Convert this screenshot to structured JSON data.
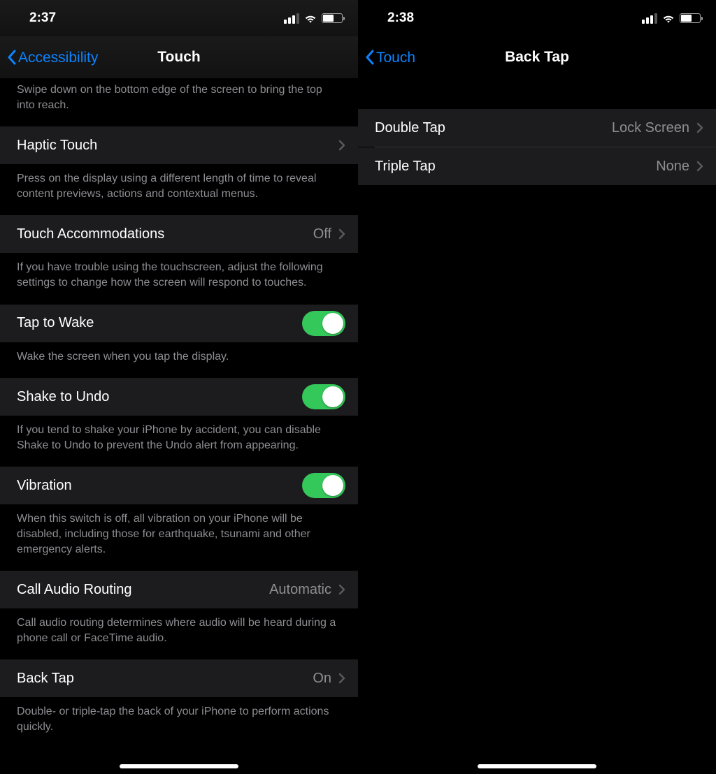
{
  "left": {
    "status_time": "2:37",
    "nav_back": "Accessibility",
    "nav_title": "Touch",
    "reachability_footer": "Swipe down on the bottom edge of the screen to bring the top into reach.",
    "haptic_touch": "Haptic Touch",
    "haptic_touch_footer": "Press on the display using a different length of time to reveal content previews, actions and contextual menus.",
    "touch_accommodations": "Touch Accommodations",
    "touch_accommodations_value": "Off",
    "touch_accommodations_footer": "If you have trouble using the touchscreen, adjust the following settings to change how the screen will respond to touches.",
    "tap_to_wake": "Tap to Wake",
    "tap_to_wake_footer": "Wake the screen when you tap the display.",
    "shake_to_undo": "Shake to Undo",
    "shake_to_undo_footer": "If you tend to shake your iPhone by accident, you can disable Shake to Undo to prevent the Undo alert from appearing.",
    "vibration": "Vibration",
    "vibration_footer": "When this switch is off, all vibration on your iPhone will be disabled, including those for earthquake, tsunami and other emergency alerts.",
    "call_audio_routing": "Call Audio Routing",
    "call_audio_routing_value": "Automatic",
    "call_audio_routing_footer": "Call audio routing determines where audio will be heard during a phone call or FaceTime audio.",
    "back_tap": "Back Tap",
    "back_tap_value": "On",
    "back_tap_footer": "Double- or triple-tap the back of your iPhone to perform actions quickly."
  },
  "right": {
    "status_time": "2:38",
    "nav_back": "Touch",
    "nav_title": "Back Tap",
    "double_tap": "Double Tap",
    "double_tap_value": "Lock Screen",
    "triple_tap": "Triple Tap",
    "triple_tap_value": "None"
  }
}
